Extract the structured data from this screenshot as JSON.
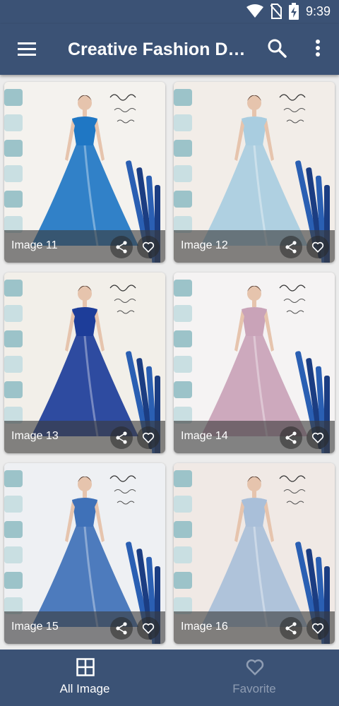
{
  "status_bar": {
    "time": "9:39",
    "icons": [
      "wifi-icon",
      "no-sim-icon",
      "battery-charging-icon"
    ]
  },
  "app_bar": {
    "title": "Creative Fashion Design",
    "menu_icon": "hamburger-menu-icon",
    "search_icon": "search-icon",
    "more_icon": "more-vert-icon"
  },
  "gallery": {
    "items": [
      {
        "label": "Image 11",
        "dress_color": "#1f77c4",
        "bg": "#f4f2ee"
      },
      {
        "label": "Image 12",
        "dress_color": "#a9cde0",
        "bg": "#f2ede8"
      },
      {
        "label": "Image 13",
        "dress_color": "#1d3d99",
        "bg": "#f2efe9"
      },
      {
        "label": "Image 14",
        "dress_color": "#c9a3b8",
        "bg": "#f5f3f3"
      },
      {
        "label": "Image 15",
        "dress_color": "#3f71b8",
        "bg": "#eef0f3"
      },
      {
        "label": "Image 16",
        "dress_color": "#a9bfd9",
        "bg": "#f0e9e5"
      }
    ],
    "share_icon": "share-icon",
    "favorite_icon": "heart-outline-icon"
  },
  "bottom_nav": {
    "items": [
      {
        "label": "All Image",
        "icon": "grid-icon",
        "active": true
      },
      {
        "label": "Favorite",
        "icon": "heart-outline-icon",
        "active": false
      }
    ],
    "active_color": "#ffffff",
    "inactive_color": "#8f9db3"
  },
  "colors": {
    "primary": "#3b5275",
    "background": "#ececec"
  }
}
